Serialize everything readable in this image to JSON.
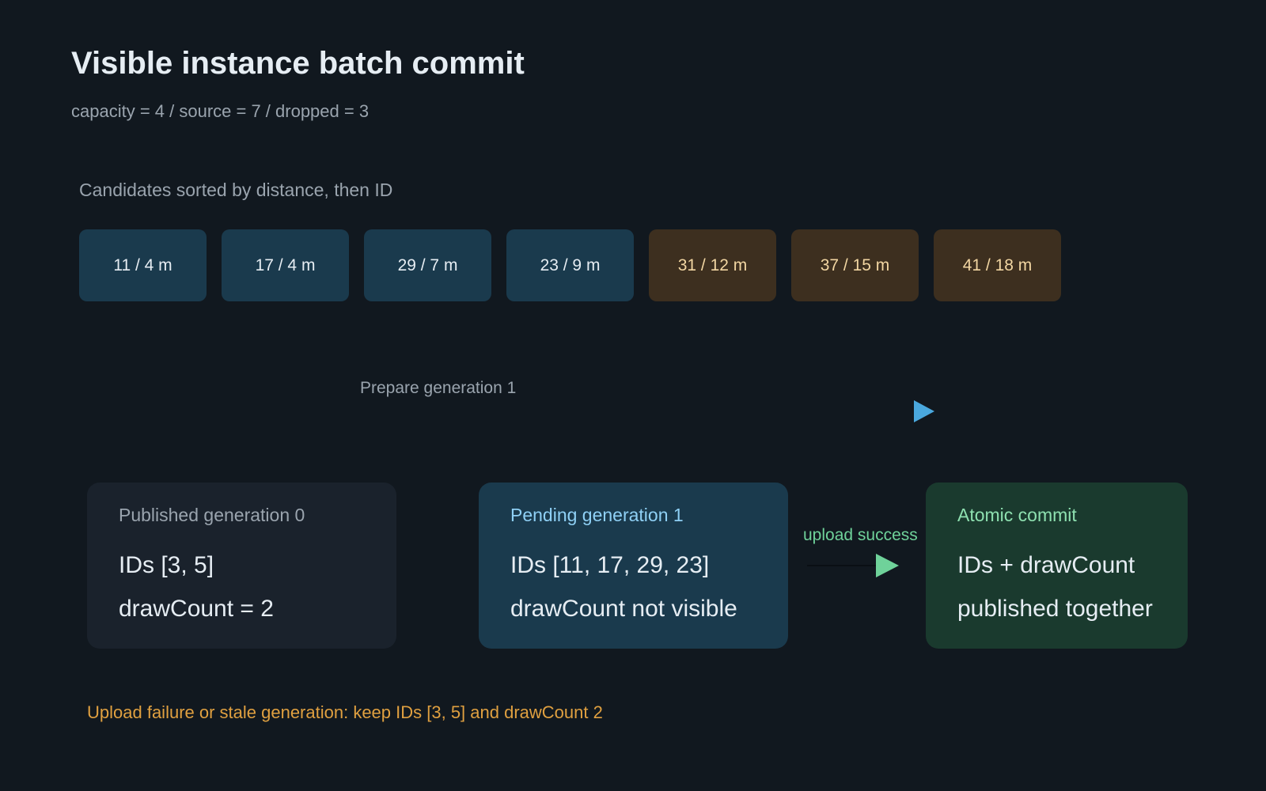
{
  "header": {
    "title": "Visible instance batch commit",
    "subtitle": "capacity = 4 / source = 7 / dropped = 3"
  },
  "candidates": {
    "label": "Candidates sorted by distance, then ID",
    "items": [
      {
        "text": "11 / 4 m",
        "status": "kept"
      },
      {
        "text": "17 / 4 m",
        "status": "kept"
      },
      {
        "text": "29 / 7 m",
        "status": "kept"
      },
      {
        "text": "23 / 9 m",
        "status": "kept"
      },
      {
        "text": "31 / 12 m",
        "status": "dropped"
      },
      {
        "text": "37 / 15 m",
        "status": "dropped"
      },
      {
        "text": "41 / 18 m",
        "status": "dropped"
      }
    ]
  },
  "prepare": {
    "label": "Prepare generation 1"
  },
  "published": {
    "title": "Published generation 0",
    "line1": "IDs [3, 5]",
    "line2": "drawCount = 2"
  },
  "pending": {
    "title": "Pending generation 1",
    "line1": "IDs [11, 17, 29, 23]",
    "line2": "drawCount not visible"
  },
  "upload": {
    "label": "upload success"
  },
  "commit": {
    "title": "Atomic commit",
    "line1": "IDs + drawCount",
    "line2": "published together"
  },
  "failure_note": "Upload failure or stale generation: keep IDs [3, 5] and drawCount 2",
  "colors": {
    "background": "#11181f",
    "kept_chip": "#1a3a4d",
    "dropped_chip": "#3d2f1f",
    "published_card": "#1a222c",
    "pending_card": "#1a3a4d",
    "commit_card": "#1a3a2e",
    "prepare_arrow": "#4aa8de",
    "success": "#6fd29a",
    "warning": "#e0a040"
  }
}
